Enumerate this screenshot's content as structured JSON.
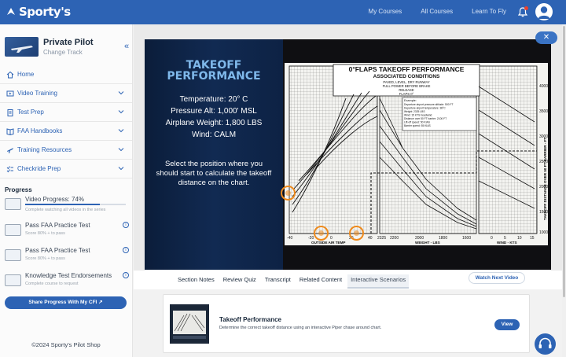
{
  "header": {
    "logo_text": "Sporty's",
    "nav": [
      "My Courses",
      "All Courses",
      "Learn To Fly"
    ],
    "notification_icon": "bell-icon",
    "avatar_icon": "user-avatar-icon",
    "brand_color": "#2d63b4"
  },
  "sidebar": {
    "course_title": "Private Pilot",
    "change_track": "Change Track",
    "items": [
      {
        "label": "Home",
        "icon": "home-icon"
      },
      {
        "label": "Video Training",
        "icon": "video-icon"
      },
      {
        "label": "Test Prep",
        "icon": "clipboard-icon"
      },
      {
        "label": "FAA Handbooks",
        "icon": "book-icon"
      },
      {
        "label": "Training Resources",
        "icon": "airplane-icon"
      },
      {
        "label": "Checkride Prep",
        "icon": "checklist-icon"
      }
    ],
    "progress_heading": "Progress",
    "progress": [
      {
        "title": "Video Progress: 74%",
        "sub": "Complete watching all videos in the series",
        "value": 0.74
      },
      {
        "title": "Pass FAA Practice Test",
        "sub": "Score 80% + to pass"
      },
      {
        "title": "Pass FAA Practice Test",
        "sub": "Score 80% + to pass"
      },
      {
        "title": "Knowledge Test Endorsements",
        "sub": "Complete course to request"
      }
    ],
    "share_button": "Share Progress With My CFI",
    "footer": "©2024 Sporty's Pilot Shop"
  },
  "video": {
    "title_line1": "TAKEOFF",
    "title_line2": "PERFORMANCE",
    "conditions": [
      "Temperature: 20° C",
      "Pressure Alt: 1,000' MSL",
      "Airplane Weight: 1,800 LBS",
      "Wind: CALM"
    ],
    "instruction": "Select the position where you should start to calculate the takeoff distance on the chart.",
    "chart_title": "0°FLAPS TAKEOFF PERFORMANCE",
    "chart_sub": "ASSOCIATED CONDITIONS",
    "chart_cond": [
      "PAVED, LEVEL, DRY RUNWAY",
      "FULL POWER BEFORE BRAKE",
      "RELEASE",
      "FLAPS 0°"
    ],
    "example_label": "Example:",
    "example": [
      "Departure airport pressure altitude: 500 FT",
      "Departure airport temperature: 38°C",
      "Weight: 2325 LBS",
      "Wind: 15 KTS headwind",
      "Distance over 50 FT barrier: 2100 FT",
      "Lift-off speed: 50 KIAS",
      "Barrier speed: 55 KIAS"
    ],
    "y_axis_label": "TAKEOFF DISTANCE OVER 50 FT BARRIER - FT",
    "y_ticks": [
      "4000",
      "3500",
      "3000",
      "2500",
      "2000",
      "1500",
      "1000"
    ],
    "x_temp_label": "OUTSIDE AIR TEMP",
    "x_weight_label": "WEIGHT - LBS",
    "x_wind_label": "WIND - KTS",
    "x_temp_ticks": [
      "-40",
      "-20",
      "0",
      "20",
      "40"
    ],
    "x_weight_ticks": [
      "2325",
      "2200",
      "2000",
      "1800",
      "1600"
    ],
    "x_wind_ticks": [
      "0",
      "5",
      "10",
      "15"
    ],
    "close_icon": "close-icon"
  },
  "tabs": [
    "Section Notes",
    "Review Quiz",
    "Transcript",
    "Related Content",
    "Interactive Scenarios"
  ],
  "active_tab": "Interactive Scenarios",
  "watch_next": "Watch Next Video",
  "card": {
    "title": "Takeoff Performance",
    "description": "Determine the correct takeoff distance using an interactive Piper chase around chart.",
    "button": "View"
  },
  "help_icon": "help-chat-icon"
}
